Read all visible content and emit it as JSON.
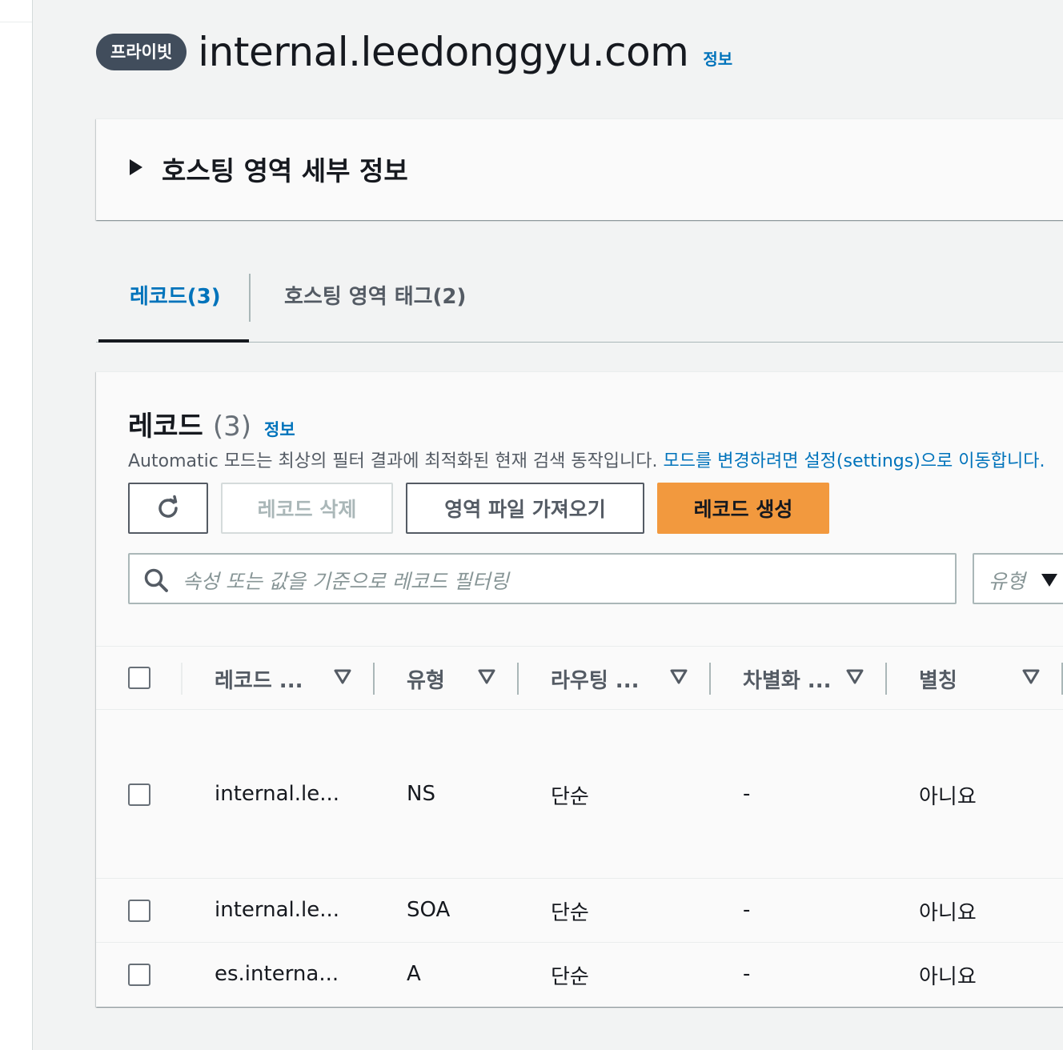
{
  "header": {
    "badge": "프라이빗",
    "title": "internal.leedonggyu.com",
    "info": "정보"
  },
  "details": {
    "title": "호스팅 영역 세부 정보"
  },
  "tabs": [
    {
      "label": "레코드(3)",
      "active": true
    },
    {
      "label": "호스팅 영역 태그(2)",
      "active": false
    }
  ],
  "records": {
    "title": "레코드",
    "count": "(3)",
    "info": "정보",
    "description": "Automatic 모드는 최상의 필터 결과에 최적화된 현재 검색 동작입니다.",
    "description_link": "모드를 변경하려면 설정(settings)으로 이동합니다.",
    "buttons": {
      "delete": "레코드 삭제",
      "import": "영역 파일 가져오기",
      "create": "레코드 생성"
    },
    "search_placeholder": "속성 또는 값을 기준으로 레코드 필터링",
    "type_filter": "유형",
    "columns": [
      "레코드 ...",
      "유형",
      "라우팅 ...",
      "차별화 ...",
      "별칭"
    ],
    "rows": [
      {
        "name": "internal.le...",
        "type": "NS",
        "routing": "단순",
        "diff": "-",
        "alias": "아니요"
      },
      {
        "name": "internal.le...",
        "type": "SOA",
        "routing": "단순",
        "diff": "-",
        "alias": "아니요"
      },
      {
        "name": "es.interna...",
        "type": "A",
        "routing": "단순",
        "diff": "-",
        "alias": "아니요"
      }
    ]
  },
  "colors": {
    "link": "#0073bb",
    "primary_button": "#f2993e",
    "badge": "#414d5c"
  }
}
